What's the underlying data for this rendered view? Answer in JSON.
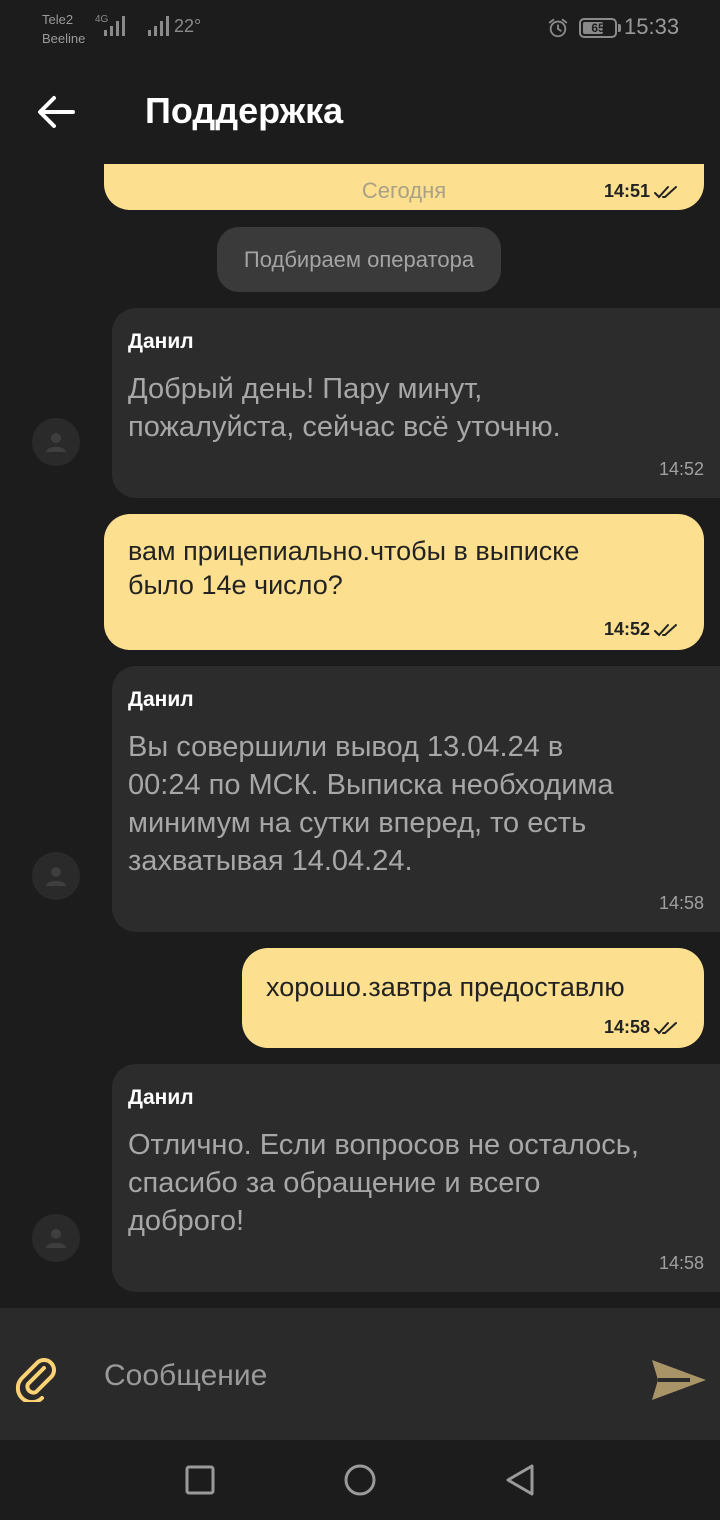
{
  "status_bar": {
    "carrier1": "Tele2",
    "carrier2": "Beeline",
    "network_type": "4G",
    "temperature": "22°",
    "battery": "65",
    "time": "15:33"
  },
  "header": {
    "title": "Поддержка"
  },
  "chat": {
    "date_separator": "Сегодня",
    "first_bubble_time": "14:51",
    "system_message": "Подбираем оператора",
    "messages": [
      {
        "direction": "in",
        "sender": "Данил",
        "lines": [
          "Добрый день! Пару минут,",
          "пожалуйста, сейчас всё уточню."
        ],
        "time": "14:52"
      },
      {
        "direction": "out",
        "lines": [
          "вам прицепиально.чтобы в выписке",
          "было 14е число?"
        ],
        "time": "14:52"
      },
      {
        "direction": "in",
        "sender": "Данил",
        "lines": [
          "Вы совершили вывод 13.04.24 в",
          "00:24 по МСК. Выписка необходима",
          "минимум на сутки вперед, то есть",
          "захватывая 14.04.24."
        ],
        "time": "14:58"
      },
      {
        "direction": "out",
        "lines": [
          "хорошо.завтра предоставлю"
        ],
        "time": "14:58"
      },
      {
        "direction": "in",
        "sender": "Данил",
        "lines": [
          "Отлично. Если вопросов не осталось,",
          "спасибо за обращение и всего",
          "доброго!"
        ],
        "time": "14:58"
      }
    ]
  },
  "input": {
    "placeholder": "Сообщение"
  },
  "colors": {
    "outgoing_bubble": "#fde08f",
    "incoming_bubble": "#2c2c2c",
    "accent": "#fcd274",
    "background": "#1c1c1c"
  },
  "icons": [
    "back-arrow-icon",
    "double-check-icon",
    "user-icon",
    "paperclip-icon",
    "send-icon",
    "nav-recents-icon",
    "nav-home-icon",
    "nav-back-icon",
    "alarm-icon",
    "battery-icon",
    "signal-icon"
  ]
}
